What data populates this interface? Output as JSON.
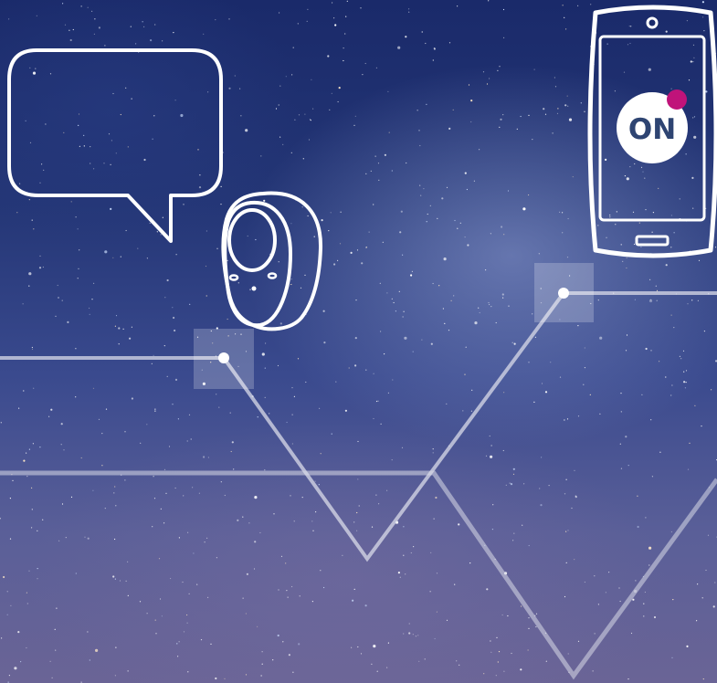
{
  "phone": {
    "power_label": "ON",
    "indicator_color": "#c0137a",
    "icon": "smartphone-icon"
  },
  "device": {
    "icon": "wearable-device-icon"
  },
  "speech_bubble": {
    "icon": "speech-bubble-icon",
    "text": ""
  },
  "colors": {
    "sky_top": "#1a2a6a",
    "sky_bottom": "#6a6496",
    "line": "#d9dbe8",
    "outline": "#ffffff"
  },
  "background": {
    "subject": "starry-night-sky",
    "icon": "milky-way-background"
  }
}
